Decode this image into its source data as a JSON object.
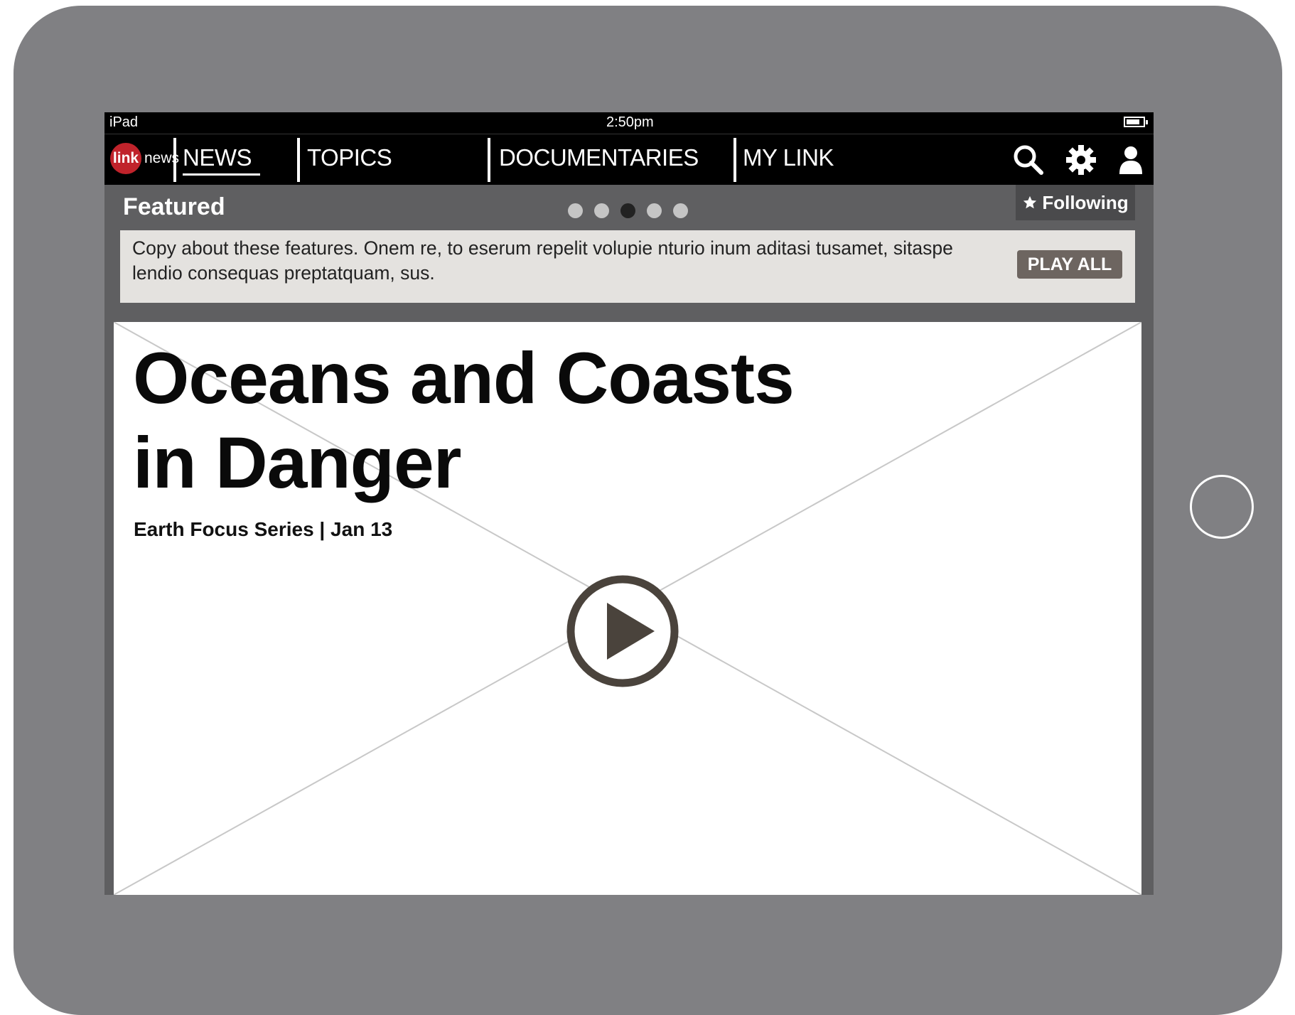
{
  "status_bar": {
    "device": "iPad",
    "time": "2:50pm"
  },
  "nav": {
    "logo_mark": "link",
    "logo_text": "news",
    "items": [
      {
        "label": "NEWS",
        "active": true
      },
      {
        "label": "TOPICS",
        "active": false
      },
      {
        "label": "DOCUMENTARIES",
        "active": false
      },
      {
        "label": "MY LINK",
        "active": false
      }
    ],
    "icons": [
      "search-icon",
      "gear-icon",
      "user-icon"
    ]
  },
  "featured": {
    "title": "Featured",
    "carousel": {
      "count": 5,
      "active_index": 2
    },
    "following_label": "Following",
    "description": "Copy about these features. Onem re, to eserum repelit volupie nturio inum aditasi tusamet, sitaspe lendio consequas preptatquam, sus.",
    "play_all_label": "PLAY ALL"
  },
  "hero": {
    "title_line1": "Oceans and Coasts",
    "title_line2": "in Danger",
    "meta": "Earth Focus Series | Jan 13"
  },
  "colors": {
    "device": "#808083",
    "logo_red": "#c0232b",
    "play_button": "#4a433c",
    "description_bg": "#e4e2df"
  }
}
